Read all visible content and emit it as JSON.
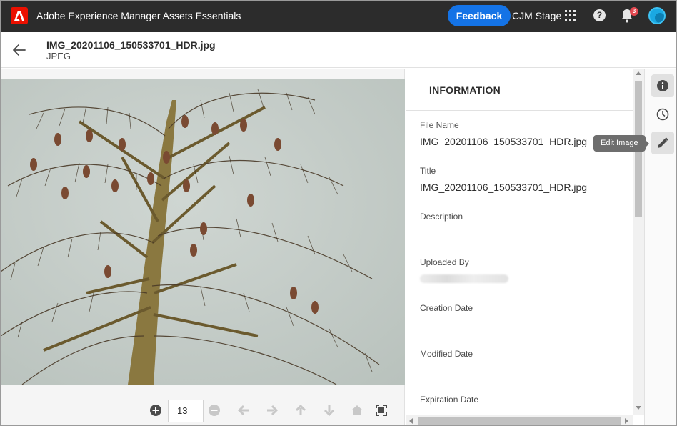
{
  "app": {
    "title": "Adobe Experience Manager Assets Essentials",
    "logo_icon": "adobe-logo-icon",
    "brand_color": "#eb1000"
  },
  "topbar": {
    "feedback_label": "Feedback",
    "org_name": "CJM Stage",
    "notifications_count": "3",
    "icons": [
      "apps-grid-icon",
      "help-icon",
      "bell-icon",
      "avatar"
    ]
  },
  "asset": {
    "file_title": "IMG_20201106_150533701_HDR.jpg",
    "file_type": "JPEG"
  },
  "viewer": {
    "page_number": "13",
    "icons": [
      "zoom-in-icon",
      "zoom-out-icon",
      "arrow-left-icon",
      "arrow-right-icon",
      "arrow-up-icon",
      "arrow-down-icon",
      "home-icon",
      "fullscreen-icon"
    ]
  },
  "panel": {
    "title": "INFORMATION",
    "fields": [
      {
        "label": "File Name",
        "value": "IMG_20201106_150533701_HDR.jpg"
      },
      {
        "label": "Title",
        "value": "IMG_20201106_150533701_HDR.jpg"
      },
      {
        "label": "Description",
        "value": ""
      },
      {
        "label": "Uploaded By",
        "value": ""
      },
      {
        "label": "Creation Date",
        "value": ""
      },
      {
        "label": "Modified Date",
        "value": ""
      },
      {
        "label": "Expiration Date",
        "value": ""
      }
    ]
  },
  "rail": {
    "buttons": [
      "info-icon",
      "history-icon",
      "edit-icon"
    ],
    "tooltip": "Edit Image"
  },
  "colors": {
    "topbar": "#2c2c2c",
    "accent": "#1473e6",
    "badge": "#e34850"
  }
}
